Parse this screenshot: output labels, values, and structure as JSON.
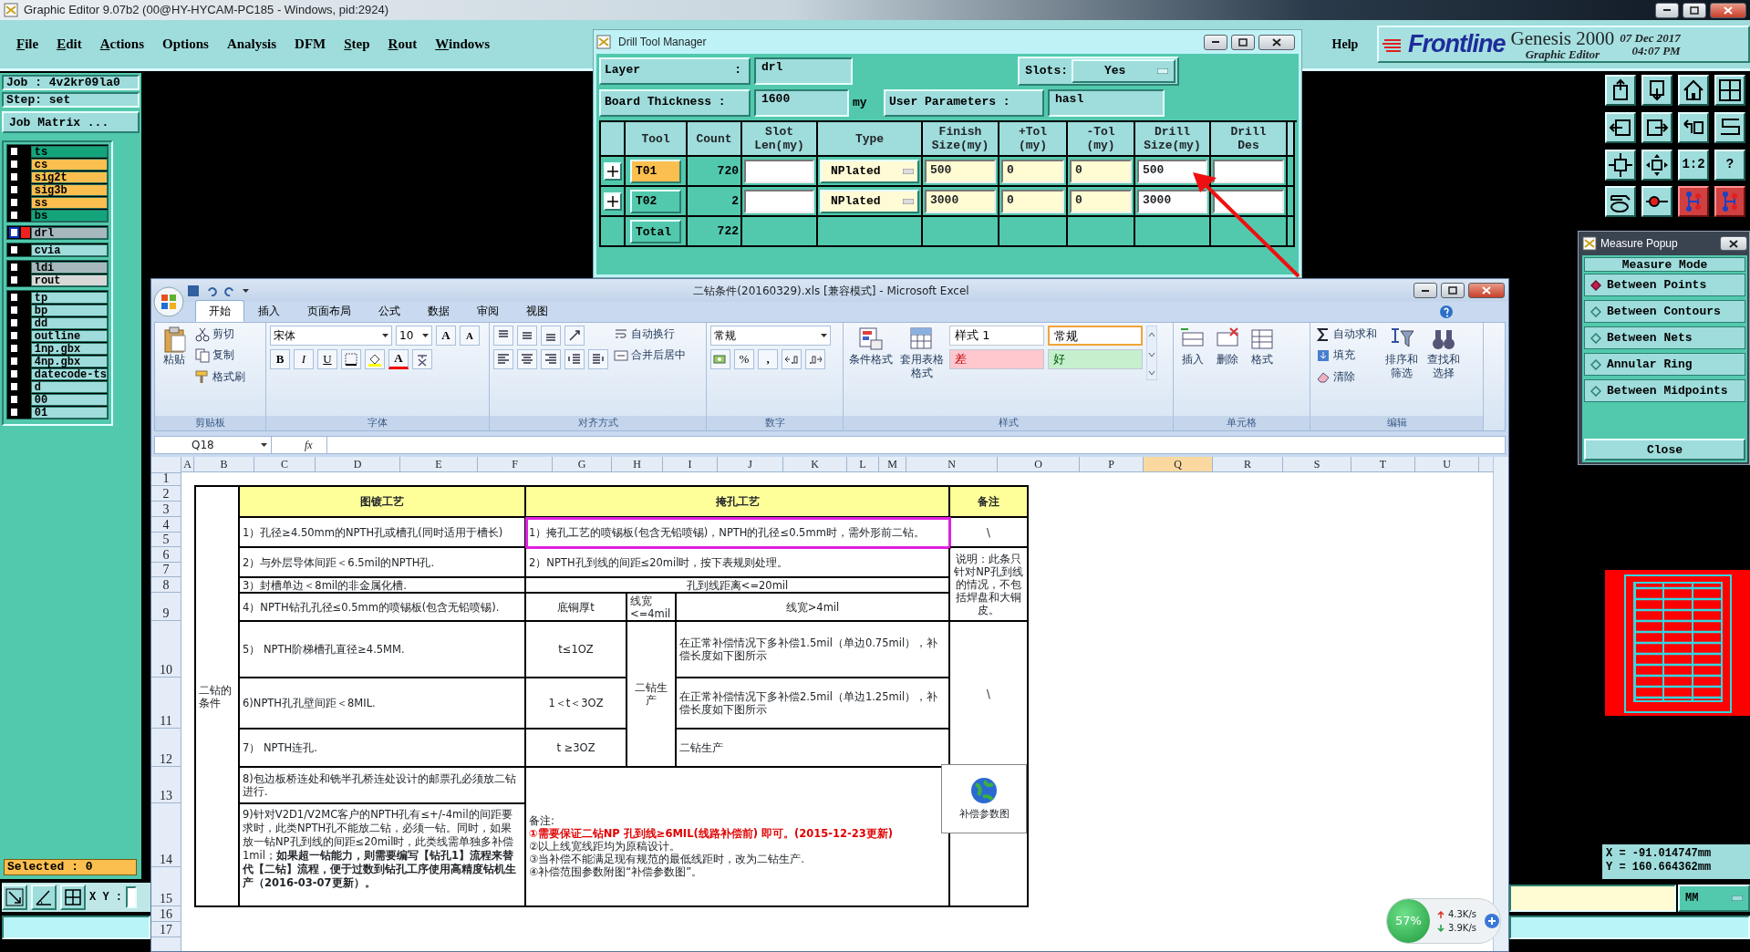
{
  "genesis": {
    "title": "Graphic Editor 9.07b2 (00@HY-HYCAM-PC185 - Windows, pid:2924)",
    "menu": [
      {
        "label": "File",
        "underlined": true
      },
      {
        "label": "Edit",
        "underlined": true
      },
      {
        "label": "Actions",
        "underlined": true
      },
      {
        "label": "Options",
        "underlined": false
      },
      {
        "label": "Analysis",
        "underlined": false
      },
      {
        "label": "DFM",
        "underlined": false
      },
      {
        "label": "Step",
        "underlined": true
      },
      {
        "label": "Rout",
        "underlined": true
      },
      {
        "label": "Windows",
        "underlined": true
      }
    ],
    "help": "Help",
    "brand": {
      "logo": "Frontline",
      "product": "Genesis 2000",
      "subtitle": "Graphic Editor",
      "date": "07 Dec 2017",
      "time": "04:07 PM"
    },
    "job": "Job : 4v2kr09la0",
    "step": "Step: set",
    "job_matrix": "Job Matrix ...",
    "layer_groups": [
      [
        {
          "name": "ts",
          "color": "#13a47c",
          "active": false,
          "checked": false
        },
        {
          "name": "cs",
          "color": "#fbbf4f",
          "active": false,
          "checked": false
        },
        {
          "name": "sig2t",
          "color": "#fbbf4f",
          "active": false,
          "checked": false
        },
        {
          "name": "sig3b",
          "color": "#fbbf4f",
          "active": false,
          "checked": false
        },
        {
          "name": "ss",
          "color": "#fbbf4f",
          "active": false,
          "checked": false
        },
        {
          "name": "bs",
          "color": "#13a47c",
          "active": false,
          "checked": false
        }
      ],
      [
        {
          "name": "drl",
          "color": "#a7b8bd",
          "active": true,
          "checked": false
        }
      ],
      [
        {
          "name": "cvia",
          "color": "#9fdcdc",
          "active": false,
          "checked": false
        }
      ],
      [
        {
          "name": "ldi",
          "color": "#a7b8bd",
          "active": false,
          "checked": false
        },
        {
          "name": "rout",
          "color": "#d8d8d8",
          "active": false,
          "checked": false
        }
      ],
      [
        {
          "name": "tp",
          "color": "#9fdcdc",
          "active": false,
          "checked": false
        },
        {
          "name": "bp",
          "color": "#9fdcdc",
          "active": false,
          "checked": false
        },
        {
          "name": "dd",
          "color": "#9fdcdc",
          "active": false,
          "checked": false
        },
        {
          "name": "outline",
          "color": "#9fdcdc",
          "active": false,
          "checked": false
        },
        {
          "name": "1np.gbx",
          "color": "#9fdcdc",
          "active": false,
          "checked": false
        },
        {
          "name": "4np.gbx",
          "color": "#9fdcdc",
          "active": false,
          "checked": false
        },
        {
          "name": "datecode-ts",
          "color": "#9fdcdc",
          "active": false,
          "checked": false
        },
        {
          "name": "d",
          "color": "#9fdcdc",
          "active": false,
          "checked": false
        },
        {
          "name": "00",
          "color": "#9fdcdc",
          "active": false,
          "checked": false
        },
        {
          "name": "01",
          "color": "#9fdcdc",
          "active": false,
          "checked": false
        }
      ]
    ],
    "selected": "Selected : 0",
    "xy_label": "X Y :",
    "toolbar": [
      {
        "kind": "up",
        "highlighted": false
      },
      {
        "kind": "down",
        "highlighted": false
      },
      {
        "kind": "home",
        "highlighted": false
      },
      {
        "kind": "grid",
        "highlighted": false
      },
      {
        "kind": "left",
        "highlighted": false
      },
      {
        "kind": "right",
        "highlighted": false
      },
      {
        "kind": "undo",
        "highlighted": false
      },
      {
        "kind": "snake",
        "highlighted": false
      },
      {
        "kind": "fit",
        "highlighted": false
      },
      {
        "kind": "pan",
        "highlighted": false
      },
      {
        "kind": "text",
        "text": "1:2",
        "highlighted": false
      },
      {
        "kind": "text",
        "text": "?",
        "highlighted": false
      },
      {
        "kind": "palette",
        "highlighted": false
      },
      {
        "kind": "probe",
        "highlighted": false
      },
      {
        "kind": "net",
        "highlighted": true
      },
      {
        "kind": "net",
        "highlighted": true
      }
    ],
    "coordinates": [
      "X = -91.014747mm",
      "Y = 160.664362mm"
    ],
    "units": "MM"
  },
  "measure_popup": {
    "title": "Measure Popup",
    "heading": "Measure Mode",
    "options": [
      {
        "label": "Between Points",
        "selected": true
      },
      {
        "label": "Between Contours",
        "selected": false
      },
      {
        "label": "Between Nets",
        "selected": false
      },
      {
        "label": "Annular Ring",
        "selected": false
      },
      {
        "label": "Between Midpoints",
        "selected": false
      }
    ],
    "close": "Close"
  },
  "drill_tool_manager": {
    "title": "Drill Tool Manager",
    "layer": {
      "label": "Layer",
      "separator": ":",
      "value": "drl"
    },
    "slots": {
      "label": "Slots:",
      "value": "Yes"
    },
    "board_thickness": {
      "label": "Board Thickness :",
      "value": "1600",
      "unit": "my"
    },
    "user_parameters": {
      "label": "User Parameters :",
      "value": "hasl"
    },
    "columns": [
      "Tool",
      "Count",
      "Slot\nLen(my)",
      "Type",
      "Finish\nSize(my)",
      "+Tol\n(my)",
      "-Tol\n(my)",
      "Drill\nSize(my)",
      "Drill\nDes"
    ],
    "rows": [
      {
        "tool": "T01",
        "count": "720",
        "type": "NPlated",
        "finish": "500",
        "plus_tol": "0",
        "minus_tol": "0",
        "drill_size": "500",
        "selected": true
      },
      {
        "tool": "T02",
        "count": "2",
        "type": "NPlated",
        "finish": "3000",
        "plus_tol": "0",
        "minus_tol": "0",
        "drill_size": "3000",
        "selected": false
      }
    ],
    "total": {
      "label": "Total",
      "count": "722"
    }
  },
  "excel": {
    "title": "二钻条件(20160329).xls  [兼容模式] - Microsoft Excel",
    "tabs": [
      {
        "label": "开始",
        "selected": true
      },
      {
        "label": "插入",
        "selected": false
      },
      {
        "label": "页面布局",
        "selected": false
      },
      {
        "label": "公式",
        "selected": false
      },
      {
        "label": "数据",
        "selected": false
      },
      {
        "label": "审阅",
        "selected": false
      },
      {
        "label": "视图",
        "selected": false
      }
    ],
    "ribbon": {
      "clipboard": {
        "label": "剪贴板",
        "paste": "粘贴",
        "cut": "剪切",
        "copy": "复制",
        "format_painter": "格式刷"
      },
      "font": {
        "label": "字体",
        "font": "宋体",
        "size": "10",
        "grow": "A",
        "shrink": "A",
        "bold": "B",
        "italic": "I",
        "underline": "U",
        "font_color": "A"
      },
      "alignment": {
        "label": "对齐方式",
        "wrap": "自动换行",
        "merge": "合并后居中"
      },
      "number": {
        "label": "数字",
        "format": "常规",
        "percent": "%",
        "comma": ","
      },
      "styles": {
        "label": "样式",
        "conditional": "条件格式",
        "table": "套用表格格式",
        "cell_styles": [
          {
            "text": "样式 1",
            "kind": "normal",
            "selected": false
          },
          {
            "text": "常规",
            "kind": "normal",
            "selected": true
          },
          {
            "text": "差",
            "kind": "bad",
            "selected": false
          },
          {
            "text": "好",
            "kind": "good",
            "selected": false
          }
        ]
      },
      "cells": {
        "label": "单元格",
        "insert": "插入",
        "delete": "删除",
        "format": "格式"
      },
      "editing": {
        "label": "编辑",
        "autosum": "自动求和",
        "fill": "填充",
        "clear": "清除",
        "sort": "排序和筛选",
        "find": "查找和选择"
      }
    },
    "name_box": "Q18",
    "fx": "fx",
    "columns": [
      {
        "label": "A",
        "selected": false
      },
      {
        "label": "B",
        "selected": false
      },
      {
        "label": "C",
        "selected": false
      },
      {
        "label": "D",
        "selected": false
      },
      {
        "label": "E",
        "selected": false
      },
      {
        "label": "F",
        "selected": false
      },
      {
        "label": "G",
        "selected": false
      },
      {
        "label": "H",
        "selected": false
      },
      {
        "label": "I",
        "selected": false
      },
      {
        "label": "J",
        "selected": false
      },
      {
        "label": "K",
        "selected": false
      },
      {
        "label": "L",
        "selected": false
      },
      {
        "label": "M",
        "selected": false
      },
      {
        "label": "N",
        "selected": false
      },
      {
        "label": "O",
        "selected": false
      },
      {
        "label": "P",
        "selected": false
      },
      {
        "label": "Q",
        "selected": true
      },
      {
        "label": "R",
        "selected": false
      },
      {
        "label": "S",
        "selected": false
      },
      {
        "label": "T",
        "selected": false
      },
      {
        "label": "U",
        "selected": false
      }
    ],
    "row_numbers": [
      "1",
      "2",
      "3",
      "4",
      "5",
      "6",
      "7",
      "8",
      "9",
      "10",
      "11",
      "12",
      "13",
      "14",
      "15",
      "16",
      "17"
    ],
    "cells": [
      {
        "kind": "label",
        "text": "二钻的条件"
      },
      {
        "kind": "header",
        "text": "图镀工艺"
      },
      {
        "kind": "header",
        "text": "掩孔工艺"
      },
      {
        "kind": "header",
        "text": "备注"
      },
      {
        "kind": "text",
        "text": "1）孔径≥4.50mm的NPTH孔或槽孔(同时适用于槽长)"
      },
      {
        "kind": "text",
        "text": "1）掩孔工艺的喷锡板(包含无铅喷锡)，NPTH的孔径≤0.5mm时，需外形前二钻。",
        "outlined": true
      },
      {
        "kind": "center",
        "text": "\\"
      },
      {
        "kind": "text",
        "text": "2）与外层导体间距＜6.5mil的NPTH孔."
      },
      {
        "kind": "text",
        "text": "2）NPTH孔到线的间距≤20mil时，按下表规则处理。"
      },
      {
        "kind": "text",
        "text": "3）封槽单边＜8mil的非金属化槽."
      },
      {
        "kind": "center",
        "text": "孔到线距离<=20mil"
      },
      {
        "kind": "text",
        "text": "4）NPTH钻孔孔径≤0.5mm的喷锡板(包含无铅喷锡)."
      },
      {
        "kind": "center",
        "text": "底铜厚t"
      },
      {
        "kind": "text",
        "text": "线宽<=4mil"
      },
      {
        "kind": "center",
        "text": "线宽>4mil"
      },
      {
        "kind": "center",
        "text": "说明：此条只针对NP孔到线的情况，不包括焊盘和大铜皮。"
      },
      {
        "kind": "text",
        "text": "5） NPTH阶梯槽孔直径≥4.5MM."
      },
      {
        "kind": "center",
        "text": "t≤1OZ"
      },
      {
        "kind": "text",
        "text": "在正常补偿情况下多补偿1.5mil（单边0.75mil），补偿长度如下图所示"
      },
      {
        "kind": "text",
        "text": "6)NPTH孔孔壁间距＜8MIL."
      },
      {
        "kind": "center",
        "text": "1＜t＜3OZ"
      },
      {
        "kind": "text",
        "text": "在正常补偿情况下多补偿2.5mil（单边1.25mil），补偿长度如下图所示"
      },
      {
        "kind": "text",
        "text": "7） NPTH连孔."
      },
      {
        "kind": "center",
        "text": "t ≥3OZ"
      },
      {
        "kind": "text",
        "text": "二钻生产"
      },
      {
        "kind": "center",
        "text": "二钻生产"
      },
      {
        "kind": "center",
        "text": "\\"
      },
      {
        "kind": "text",
        "text": "8)包边板桥连处和铣半孔桥连处设计的邮票孔必须放二钻进行."
      },
      {
        "kind": "text",
        "text": "9)针对V2D1/V2MC客户的NPTH孔有≤+/-4mil的间距要求时，此类NPTH孔不能放二钻，必须一钻。同时，如果放一钻NP孔到线的间距≤20mil时，此类线需单独多补偿1mil；**如果超一钻能力，则需要编写【钻孔1】流程来替代【二钻】流程，便于过数到钻孔工序使用高精度钻机生产（2016-03-07更新）。**"
      },
      {
        "kind": "notes",
        "lines": [
          {
            "text": "备注:",
            "warning": false
          },
          {
            "text": "①需要保证二钻NP 孔到线≥6MIL(线路补偿前) 即可。(2015-12-23更新)",
            "warning": true
          },
          {
            "text": "②以上线宽线距均为原稿设计。",
            "warning": false
          },
          {
            "text": "③当补偿不能满足现有规范的最低线距时，改为二钻生产.",
            "warning": false
          },
          {
            "text": "④补偿范围参数附图“补偿参数图”。",
            "warning": false
          }
        ]
      },
      {
        "kind": "object",
        "text": "补偿参数图"
      }
    ]
  },
  "net_monitor": {
    "cpu": "57%",
    "upload": "4.3K/s",
    "download": "3.9K/s"
  }
}
